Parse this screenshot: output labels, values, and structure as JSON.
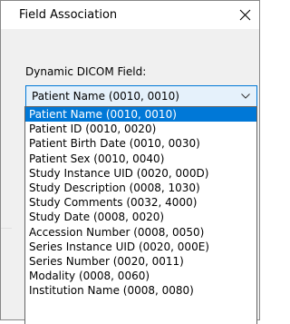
{
  "dialog": {
    "title": "Field Association",
    "close_icon": "close-icon"
  },
  "field": {
    "label": "Dynamic DICOM Field:",
    "selected_value": "Patient Name (0010, 0010)",
    "arrow_icon": "chevron-down-icon",
    "options": [
      "Patient Name (0010, 0010)",
      "Patient ID (0010, 0020)",
      "Patient Birth Date (0010, 0030)",
      "Patient Sex (0010, 0040)",
      "Study Instance UID (0020, 000D)",
      "Study Description (0008, 1030)",
      "Study Comments (0032, 4000)",
      "Study Date (0008, 0020)",
      "Accession Number (0008, 0050)",
      "Series Instance UID (0020, 000E)",
      "Series Number (0020, 0011)",
      "Modality (0008, 0060)",
      "Institution Name (0008, 0080)"
    ],
    "highlighted_index": 0
  },
  "colors": {
    "highlight": "#0078d7",
    "combo_focus_bg": "#e5f1fb",
    "dialog_bg": "#f0f0f0"
  }
}
